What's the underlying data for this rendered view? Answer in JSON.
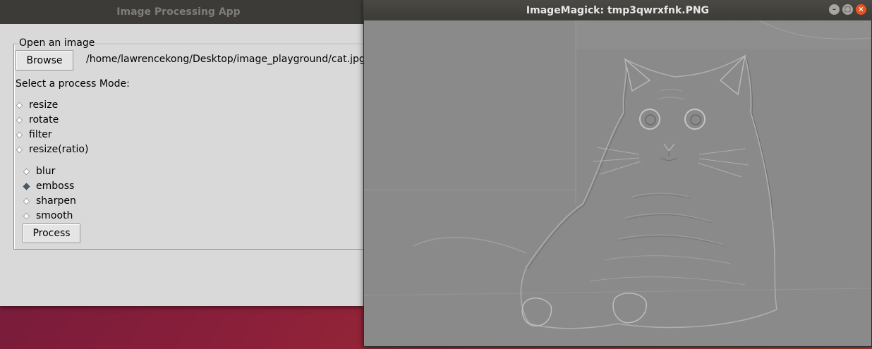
{
  "app": {
    "title": "Image Processing App",
    "frame_label": "Open an image",
    "browse_label": "Browse",
    "file_path": "/home/lawrencekong/Desktop/image_playground/cat.jpg",
    "mode_prompt": "Select a process Mode:",
    "modes": [
      "resize",
      "rotate",
      "filter",
      "resize(ratio)"
    ],
    "filters": [
      "blur",
      "emboss",
      "sharpen",
      "smooth"
    ],
    "selected_filter": "emboss",
    "process_label": "Process"
  },
  "viewer": {
    "title": "ImageMagick: tmp3qwrxfnk.PNG",
    "image_description_icon": "embossed-cat-image"
  },
  "colors": {
    "titlebar": "#3c3b37",
    "window_bg": "#d9d9d9",
    "close_button": "#e95420",
    "emboss_gray": "#8b8b8b"
  }
}
